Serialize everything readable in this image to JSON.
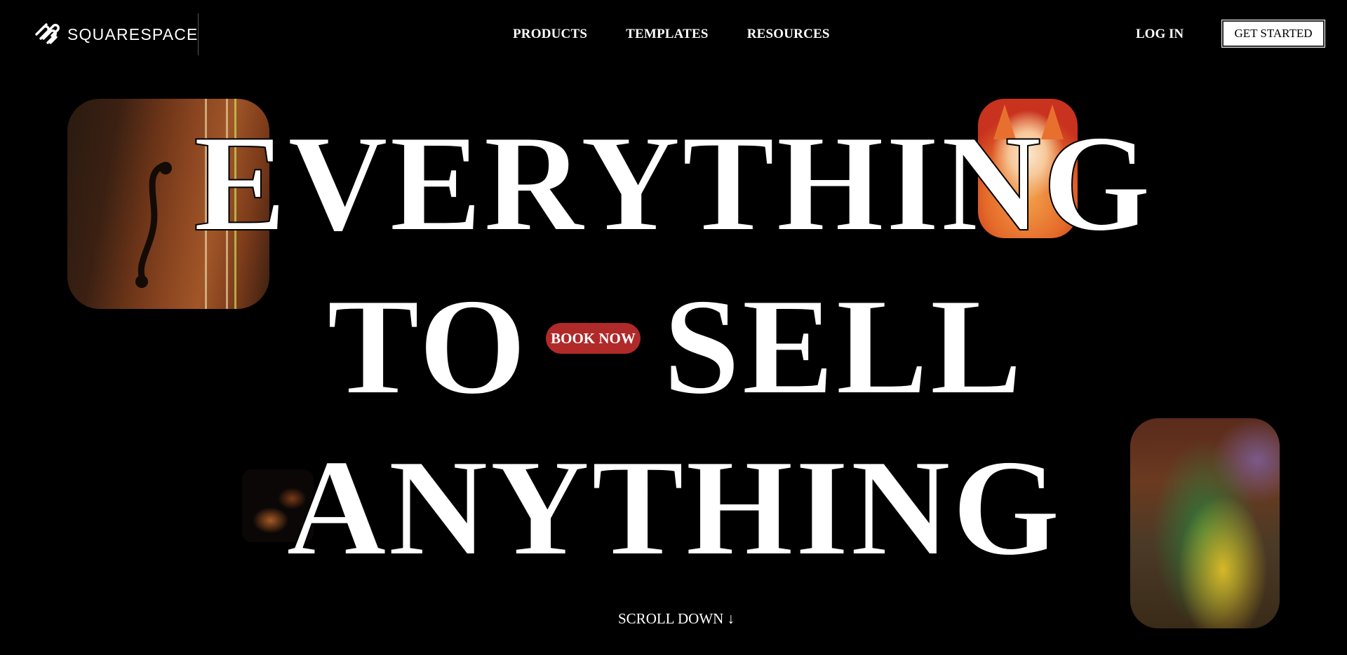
{
  "header": {
    "logo_text": "SQUARESPACE",
    "nav": [
      {
        "label": "PRODUCTS"
      },
      {
        "label": "TEMPLATES"
      },
      {
        "label": "RESOURCES"
      }
    ],
    "login_label": "LOG IN",
    "cta_label": "GET STARTED"
  },
  "hero": {
    "line1": "EVERYTHING",
    "line2_left": "TO",
    "line2_right": "SELL",
    "line3": "ANYTHING",
    "book_now_label": "BOOK NOW",
    "scroll_label": "SCROLL DOWN ↓"
  },
  "images": {
    "violin": "violin-photo",
    "fox": "fox-watercolor",
    "orchestra": "orchestra-photo",
    "painting": "painting-sorceress"
  },
  "colors": {
    "background": "#000000",
    "text": "#ffffff",
    "book_now": "#b02a2a"
  }
}
